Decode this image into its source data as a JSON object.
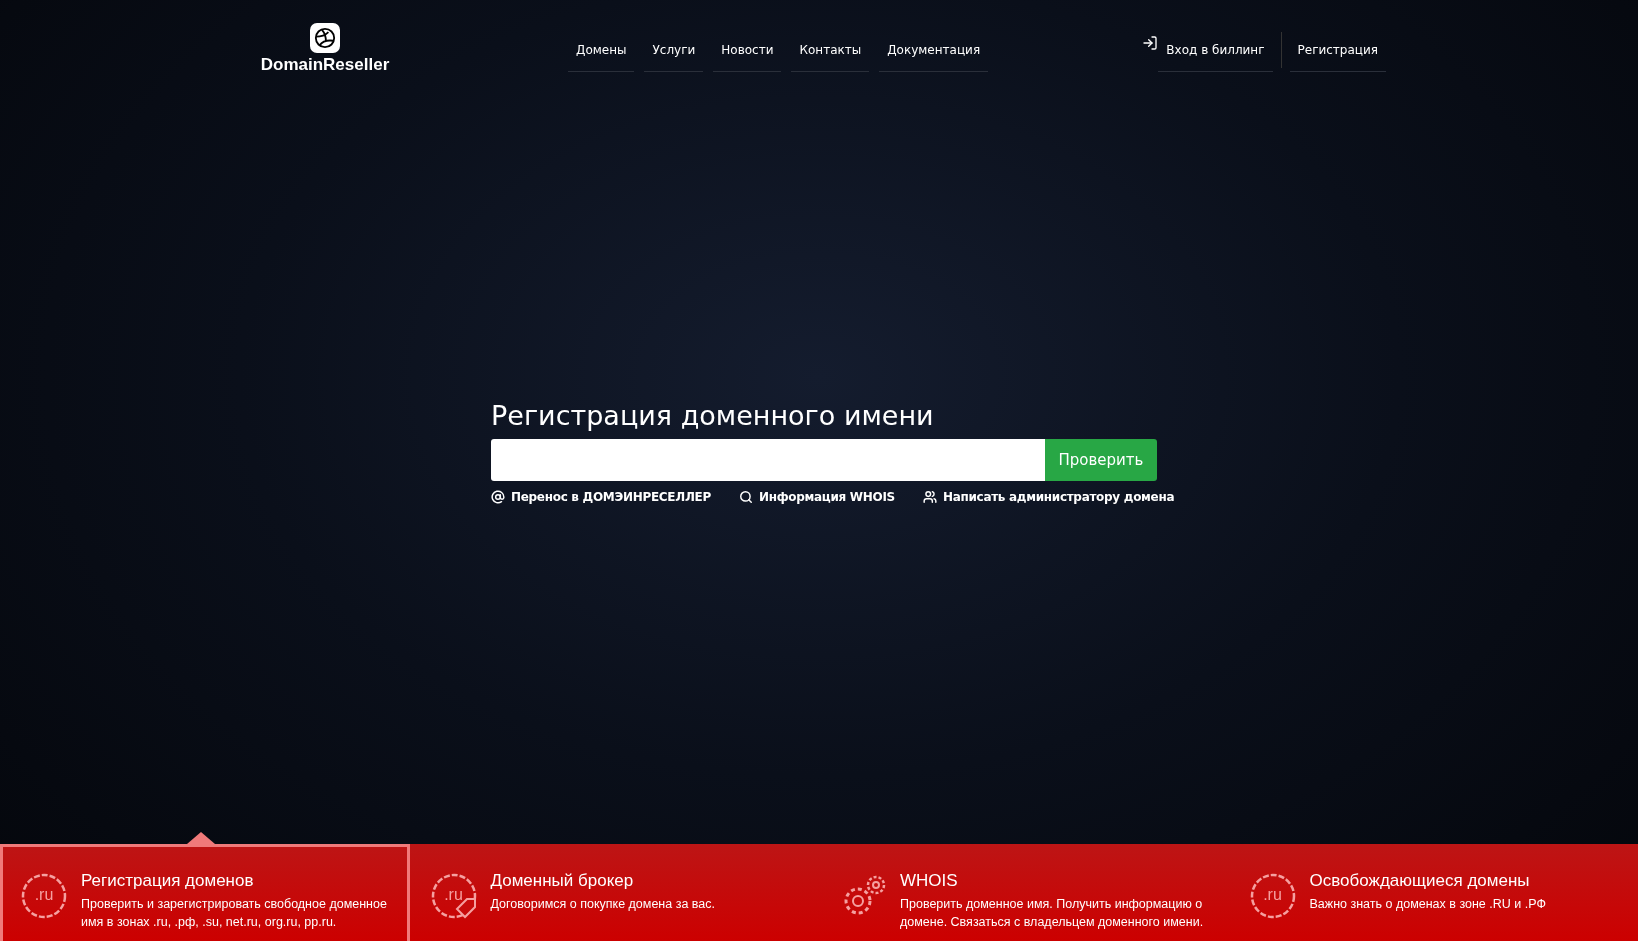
{
  "logo": {
    "text": "DomainReseller"
  },
  "nav": [
    {
      "label": "Домены"
    },
    {
      "label": "Услуги"
    },
    {
      "label": "Новости"
    },
    {
      "label": "Контакты"
    },
    {
      "label": "Документация"
    }
  ],
  "account": {
    "login": "Вход в биллинг",
    "register": "Регистрация"
  },
  "hero": {
    "title": "Регистрация доменного имени",
    "button": "Проверить",
    "links": [
      {
        "kind": "at",
        "label": "Перенос в ДОМЭИНРЕСЕЛЛЕР"
      },
      {
        "kind": "search",
        "label": "Информация WHOIS"
      },
      {
        "kind": "users",
        "label": "Написать администратору домена"
      }
    ]
  },
  "features": [
    {
      "kind": "ru",
      "icon_text": ".ru",
      "title": "Регистрация доменов",
      "text": "Проверить и зарегистрировать свободное доменное имя в зонах .ru, .рф, .su, net.ru, org.ru, pp.ru.",
      "selected": true
    },
    {
      "kind": "ru-tag",
      "icon_text": ".ru",
      "title": "Доменный брокер",
      "text": "Договоримся о покупке домена за вас.",
      "selected": false
    },
    {
      "kind": "gears",
      "title": "WHOIS",
      "text": "Проверить доменное имя. Получить информацию о домене. Связаться с владельцем доменного имени.",
      "selected": false
    },
    {
      "kind": "ru",
      "icon_text": ".ru",
      "title": "Освобождающиеся домены",
      "text": "Важно знать о доменах в зоне .RU и .РФ",
      "selected": false
    }
  ]
}
